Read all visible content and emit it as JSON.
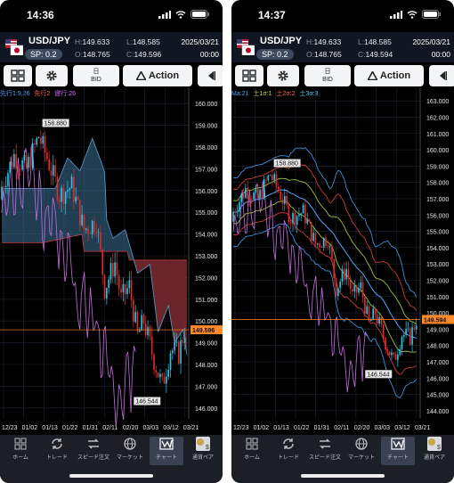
{
  "colors": {
    "accent": "#1976d2",
    "bg": "#000000",
    "bull": "#2cc8e8",
    "bear": "#e02b2b",
    "ichimokuBand": "#4a8ab0",
    "ichimokuCloudRed": "#8b1a1a",
    "lagLine": "#c66de0"
  },
  "screens": [
    {
      "status": {
        "time": "14:36"
      },
      "quote": {
        "pair": "USD/JPY",
        "spread": "SP: 0.2",
        "high_label": "H:",
        "high": "149.633",
        "low_label": "L:",
        "low": "148.585",
        "open_label": "O:",
        "open": "148.765",
        "close_label": "C:",
        "close": "149.596",
        "date": "2025/03/21",
        "time": "00:00"
      },
      "toolbar": {
        "grid_icon": "grid-icon",
        "gear_icon": "gear-icon",
        "bid_line1": "日",
        "bid_line2": "BID",
        "action_label": "Action",
        "collapse_icon": "collapse-left-icon"
      },
      "indicator": {
        "a": "先行1:9,26",
        "b": "先行2",
        "b_val": "",
        "c": "遅行:26"
      },
      "chart": {
        "yticks": [
          "160.000",
          "159.000",
          "158.000",
          "157.000",
          "156.000",
          "155.000",
          "154.000",
          "153.000",
          "152.000",
          "151.000",
          "150.000",
          "149.000",
          "148.000",
          "147.000",
          "146.000"
        ],
        "xticks": [
          "12/23",
          "01/02",
          "01/13",
          "01/22",
          "01/31",
          "02/11",
          "02/20",
          "03/03",
          "03/12",
          "03/21"
        ],
        "high_label": "158.880",
        "low_label": "146.544",
        "current_price": "149.596",
        "ymin": 145.5,
        "ymax": 160.5
      },
      "tabs": [
        {
          "label": "ホーム",
          "icon": "home-grid-icon"
        },
        {
          "label": "トレード",
          "icon": "trade-arrows-icon"
        },
        {
          "label": "スピード注文",
          "icon": "speed-order-icon"
        },
        {
          "label": "マーケット",
          "icon": "globe-icon"
        },
        {
          "label": "チャート",
          "icon": "chart-icon"
        },
        {
          "label": "通貨ペア",
          "icon": "currency-pair-icon"
        }
      ]
    },
    {
      "status": {
        "time": "14:37"
      },
      "quote": {
        "pair": "USD/JPY",
        "spread": "SP: 0.2",
        "high_label": "H:",
        "high": "149.633",
        "low_label": "L:",
        "low": "148.585",
        "open_label": "O:",
        "open": "148.765",
        "close_label": "C:",
        "close": "149.594",
        "date": "2025/03/21",
        "time": "00:00"
      },
      "toolbar": {
        "grid_icon": "grid-icon",
        "gear_icon": "gear-icon",
        "bid_line1": "日",
        "bid_line2": "BID",
        "action_label": "Action",
        "collapse_icon": "collapse-left-icon"
      },
      "indicator": {
        "a": "Ma:21",
        "b": "土1σ:1",
        "c": "土2σ:2",
        "d": "土3σ:3"
      },
      "chart": {
        "yticks": [
          "163.000",
          "162.000",
          "161.000",
          "160.000",
          "159.000",
          "158.000",
          "157.000",
          "156.000",
          "155.000",
          "154.000",
          "153.000",
          "152.000",
          "151.000",
          "150.000",
          "149.000",
          "148.000",
          "147.000",
          "146.000",
          "145.000",
          "144.000"
        ],
        "xticks": [
          "12/23",
          "01/02",
          "01/13",
          "01/22",
          "01/31",
          "02/11",
          "02/20",
          "03/03",
          "03/12",
          "03/21"
        ],
        "high_label": "158.880",
        "low_label": "146.544",
        "current_price": "149.594",
        "ymin": 143.5,
        "ymax": 163.5
      },
      "tabs": [
        {
          "label": "ホーム",
          "icon": "home-grid-icon"
        },
        {
          "label": "トレード",
          "icon": "trade-arrows-icon"
        },
        {
          "label": "スピード注文",
          "icon": "speed-order-icon"
        },
        {
          "label": "マーケット",
          "icon": "globe-icon"
        },
        {
          "label": "チャート",
          "icon": "chart-icon"
        },
        {
          "label": "通貨ペア",
          "icon": "currency-pair-icon"
        }
      ]
    }
  ],
  "chart_data": [
    {
      "type": "candlestick",
      "title": "USD/JPY",
      "xlabel": "",
      "ylabel": "",
      "x": [
        "12/23",
        "01/02",
        "01/13",
        "01/22",
        "01/31",
        "02/11",
        "02/20",
        "03/03",
        "03/12",
        "03/21"
      ],
      "close_series": {
        "name": "",
        "values": [
          157.2,
          157.6,
          158.4,
          156.2,
          155.0,
          154.5,
          152.5,
          150.5,
          149.0,
          148.0,
          148.9,
          149.6
        ]
      },
      "annotations": {
        "high": 158.88,
        "low": 146.544,
        "last": 149.596
      },
      "ylim": [
        145.5,
        160.5
      ],
      "overlays": [
        "ichimoku"
      ]
    },
    {
      "type": "candlestick",
      "title": "USD/JPY",
      "xlabel": "",
      "ylabel": "",
      "x": [
        "12/23",
        "01/02",
        "01/13",
        "01/22",
        "01/31",
        "02/11",
        "02/20",
        "03/03",
        "03/12",
        "03/21"
      ],
      "close_series": {
        "name": "",
        "values": [
          157.2,
          157.6,
          158.4,
          156.2,
          155.0,
          154.5,
          152.5,
          150.5,
          149.0,
          148.0,
          148.9,
          149.6
        ]
      },
      "annotations": {
        "high": 158.88,
        "low": 146.544,
        "last": 149.594
      },
      "ylim": [
        143.5,
        163.5
      ],
      "overlays": [
        "bollinger"
      ]
    }
  ]
}
